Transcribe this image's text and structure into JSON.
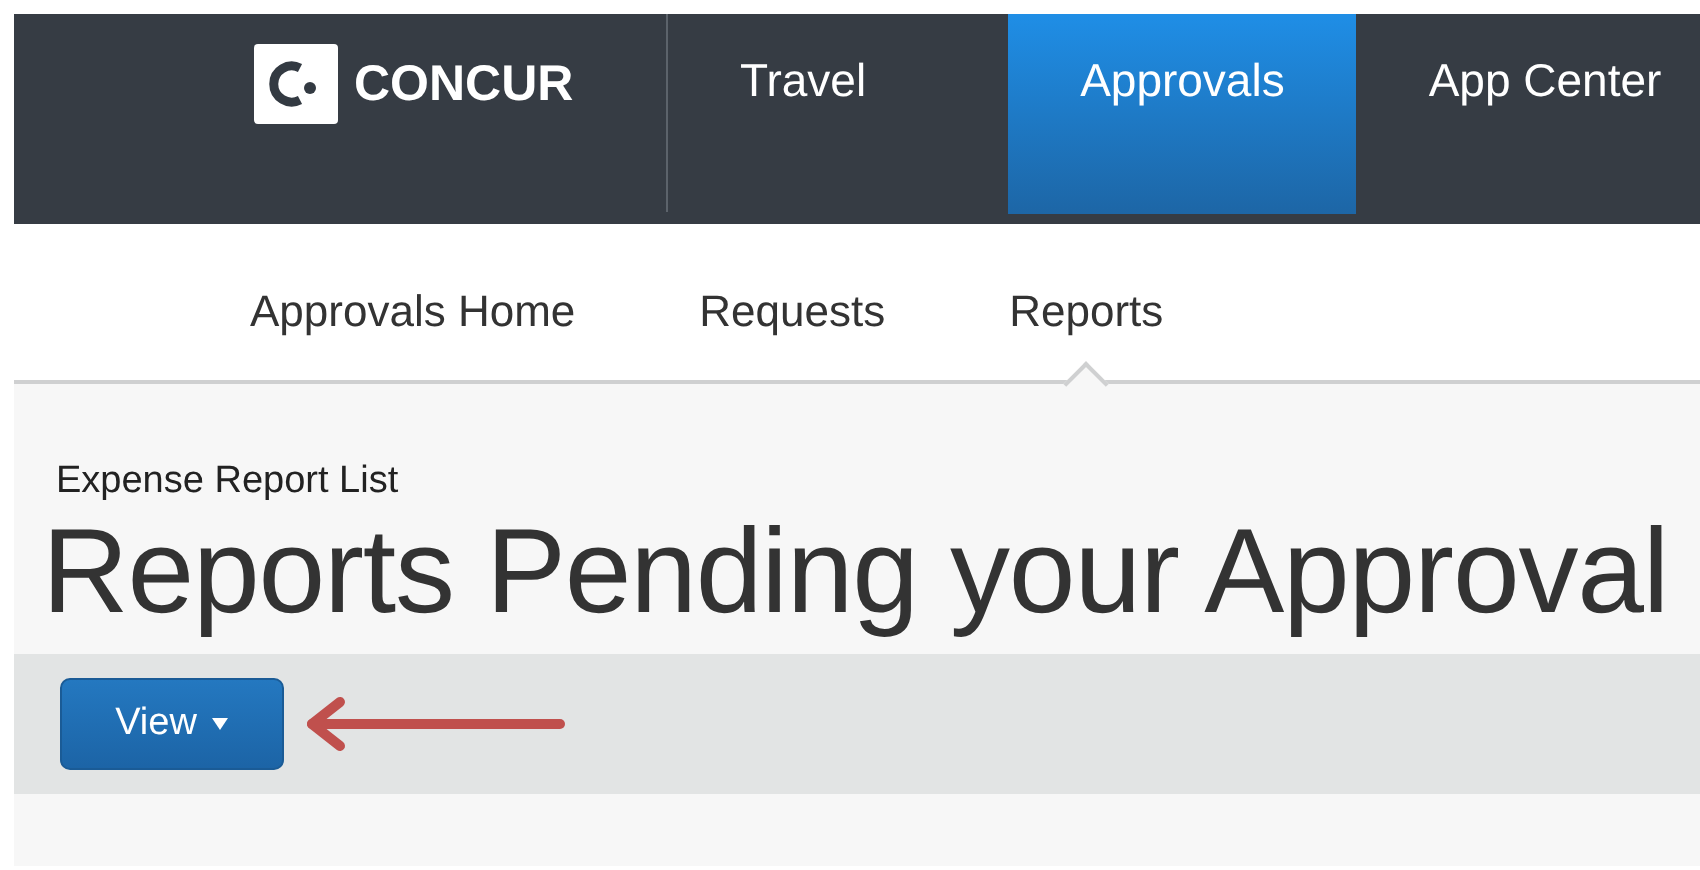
{
  "brand": {
    "name": "CONCUR"
  },
  "main_nav": [
    {
      "label": "Travel",
      "selected": false
    },
    {
      "label": "Approvals",
      "selected": true
    },
    {
      "label": "App Center",
      "selected": false
    }
  ],
  "sub_nav": [
    {
      "label": "Approvals Home",
      "selected": false
    },
    {
      "label": "Requests",
      "selected": false
    },
    {
      "label": "Reports",
      "selected": true
    }
  ],
  "page": {
    "breadcrumb": "Expense Report List",
    "title": "Reports Pending your Approval"
  },
  "toolbar": {
    "view_button": "View"
  }
}
